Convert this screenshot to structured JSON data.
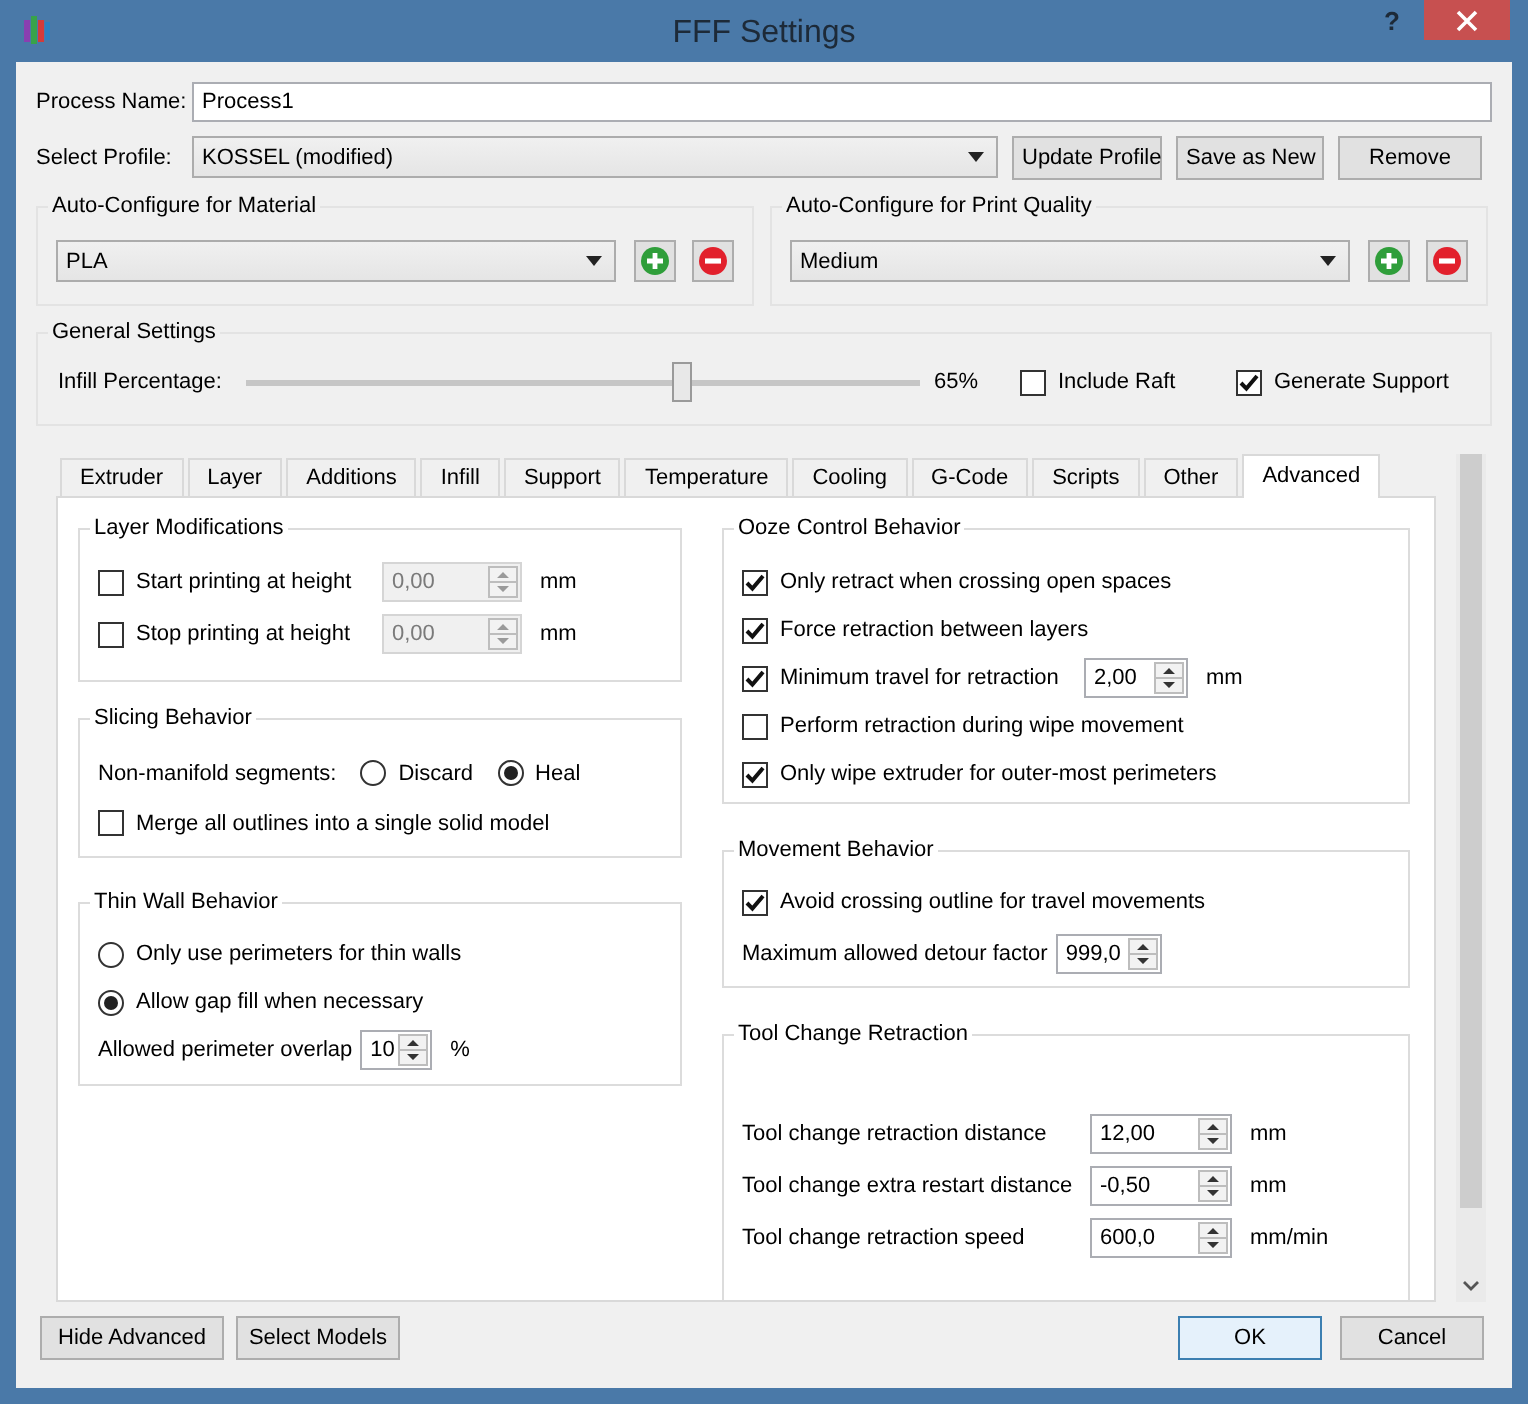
{
  "window": {
    "title": "FFF Settings",
    "help": "?"
  },
  "process_name": {
    "label": "Process Name:",
    "value": "Process1"
  },
  "profile": {
    "label": "Select Profile:",
    "value": "KOSSEL (modified)",
    "buttons": [
      "Update Profile",
      "Save as New",
      "Remove"
    ]
  },
  "material": {
    "title": "Auto-Configure for Material",
    "value": "PLA"
  },
  "print_quality": {
    "title": "Auto-Configure for Print Quality",
    "value": "Medium"
  },
  "general": {
    "title": "General Settings",
    "infill": {
      "label": "Infill Percentage:",
      "level": 0.65,
      "reading": "65%"
    },
    "checks": [
      {
        "label": "Include Raft",
        "checked": false
      },
      {
        "label": "Generate Support",
        "checked": true
      }
    ]
  },
  "tabs": [
    {
      "label": "Extruder",
      "selected": false
    },
    {
      "label": "Layer",
      "selected": false
    },
    {
      "label": "Additions",
      "selected": false
    },
    {
      "label": "Infill",
      "selected": false
    },
    {
      "label": "Support",
      "selected": false
    },
    {
      "label": "Temperature",
      "selected": false
    },
    {
      "label": "Cooling",
      "selected": false
    },
    {
      "label": "G-Code",
      "selected": false
    },
    {
      "label": "Scripts",
      "selected": false
    },
    {
      "label": "Other",
      "selected": false
    },
    {
      "label": "Advanced",
      "selected": true
    }
  ],
  "left_groups": [
    {
      "title": "Layer Modifications",
      "rows": [
        {
          "kind": "check",
          "label": "Start printing at height",
          "checked": false,
          "spin": {
            "value": "0,00",
            "disabled": true
          },
          "unit": "mm"
        },
        {
          "kind": "check",
          "label": "Stop printing at height",
          "checked": false,
          "spin": {
            "value": "0,00",
            "disabled": true
          },
          "unit": "mm"
        }
      ]
    },
    {
      "title": "Slicing Behavior",
      "rows": [
        {
          "kind": "radio_choice",
          "label": "Non-manifold segments:",
          "options": [
            {
              "label": "Discard",
              "selected": false
            },
            {
              "label": "Heal",
              "selected": true
            }
          ]
        },
        {
          "kind": "check",
          "label": "Merge all outlines into a single solid model",
          "checked": false
        }
      ]
    },
    {
      "title": "Thin Wall Behavior",
      "rows": [
        {
          "kind": "radio",
          "label": "Only use perimeters for thin walls",
          "selected": false
        },
        {
          "kind": "radio",
          "label": "Allow gap fill when necessary",
          "selected": true
        },
        {
          "kind": "spin",
          "label": "Allowed perimeter overlap",
          "spin": {
            "value": "10",
            "disabled": false
          },
          "unit": "%"
        }
      ]
    }
  ],
  "right_groups": [
    {
      "title": "Ooze Control Behavior",
      "rows": [
        {
          "kind": "check",
          "label": "Only retract when crossing open spaces",
          "checked": true
        },
        {
          "kind": "check",
          "label": "Force retraction between layers",
          "checked": true
        },
        {
          "kind": "check",
          "label": "Minimum travel for retraction",
          "checked": true,
          "spin": {
            "value": "2,00",
            "disabled": false
          },
          "unit": "mm"
        },
        {
          "kind": "check",
          "label": "Perform retraction during wipe movement",
          "checked": false
        },
        {
          "kind": "check",
          "label": "Only wipe extruder for outer-most perimeters",
          "checked": true
        }
      ]
    },
    {
      "title": "Movement Behavior",
      "rows": [
        {
          "kind": "check",
          "label": "Avoid crossing outline for travel movements",
          "checked": true
        },
        {
          "kind": "spin",
          "label": "Maximum allowed detour factor",
          "spin": {
            "value": "999,0",
            "disabled": false
          }
        }
      ]
    },
    {
      "title": "Tool Change Retraction",
      "rows": [
        {
          "kind": "spin",
          "label": "Tool change retraction distance",
          "spin": {
            "value": "12,00",
            "disabled": false
          },
          "unit": "mm"
        },
        {
          "kind": "spin",
          "label": "Tool change extra restart distance",
          "spin": {
            "value": "-0,50",
            "disabled": false
          },
          "unit": "mm"
        },
        {
          "kind": "spin",
          "label": "Tool change retraction speed",
          "spin": {
            "value": "600,0",
            "disabled": false
          },
          "unit": "mm/min"
        }
      ]
    }
  ],
  "footer": {
    "left_buttons": [
      {
        "label": "Hide Advanced",
        "default": false
      },
      {
        "label": "Select Models",
        "default": false
      }
    ],
    "right_buttons": [
      {
        "label": "OK",
        "default": true
      },
      {
        "label": "Cancel",
        "default": false
      }
    ]
  }
}
